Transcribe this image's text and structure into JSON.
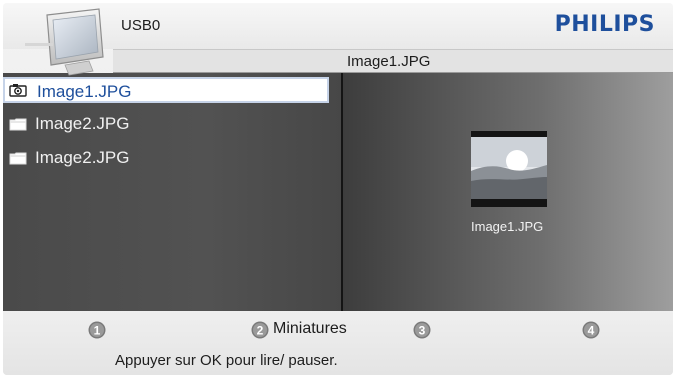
{
  "header": {
    "source": "USB0",
    "brand": "PHILIPS",
    "title": "Image1.JPG"
  },
  "files": {
    "items": [
      {
        "name": "Image1.JPG",
        "icon": "camera-icon",
        "selected": true
      },
      {
        "name": "Image2.JPG",
        "icon": "folder-icon",
        "selected": false
      },
      {
        "name": "Image2.JPG",
        "icon": "folder-icon",
        "selected": false
      }
    ]
  },
  "preview": {
    "filename": "Image1.JPG",
    "icon": "image-thumbnail-icon"
  },
  "footer": {
    "buttons": [
      {
        "number": "1",
        "label": ""
      },
      {
        "number": "2",
        "label": "Miniatures"
      },
      {
        "number": "3",
        "label": ""
      },
      {
        "number": "4",
        "label": ""
      }
    ],
    "hint": "Appuyer sur OK pour lire/ pauser."
  },
  "colors": {
    "brand": "#1e4f9c",
    "selected_text": "#1e4f9c",
    "list_background": "#4f4f4f",
    "panel_background": "#ececec"
  }
}
